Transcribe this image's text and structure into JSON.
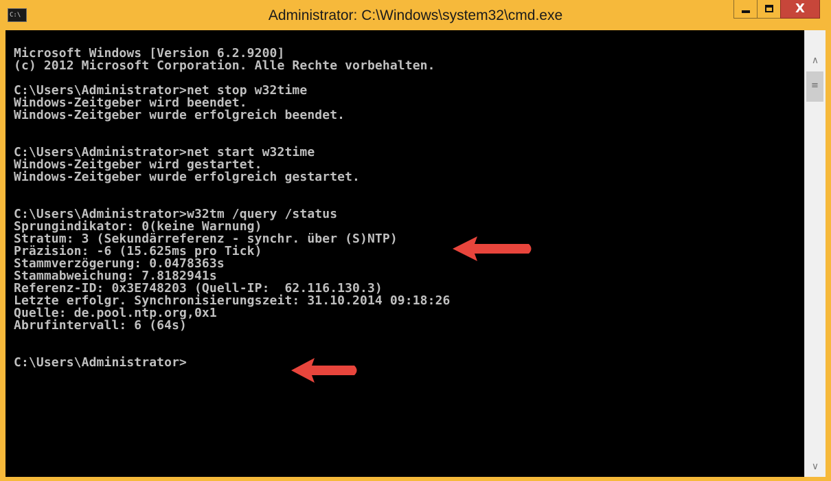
{
  "window": {
    "title": "Administrator: C:\\Windows\\system32\\cmd.exe",
    "icon_label": "C:\\"
  },
  "caption": {
    "close_label": "X"
  },
  "console_lines": [
    "Microsoft Windows [Version 6.2.9200]",
    "(c) 2012 Microsoft Corporation. Alle Rechte vorbehalten.",
    "",
    "C:\\Users\\Administrator>net stop w32time",
    "Windows-Zeitgeber wird beendet.",
    "Windows-Zeitgeber wurde erfolgreich beendet.",
    "",
    "",
    "C:\\Users\\Administrator>net start w32time",
    "Windows-Zeitgeber wird gestartet.",
    "Windows-Zeitgeber wurde erfolgreich gestartet.",
    "",
    "",
    "C:\\Users\\Administrator>w32tm /query /status",
    "Sprungindikator: 0(keine Warnung)",
    "Stratum: 3 (Sekundärreferenz - synchr. über (S)NTP)",
    "Präzision: -6 (15.625ms pro Tick)",
    "Stammverzögerung: 0.0478363s",
    "Stammabweichung: 7.8182941s",
    "Referenz-ID: 0x3E748203 (Quell-IP:  62.116.130.3)",
    "Letzte erfolgr. Synchronisierungszeit: 31.10.2014 09:18:26",
    "Quelle: de.pool.ntp.org,0x1",
    "Abrufintervall: 6 (64s)",
    "",
    "",
    "C:\\Users\\Administrator>"
  ],
  "colors": {
    "title_bar": "#f6b93b",
    "close_button": "#c7463a",
    "console_bg": "#000000",
    "console_text": "#c0c0c0",
    "annotation_arrow": "#e8453c"
  },
  "icons": {
    "minimize": "minimize-icon",
    "maximize": "maximize-icon",
    "close": "close-icon",
    "scroll_up": "chevron-up-icon",
    "scroll_down": "chevron-down-icon"
  }
}
